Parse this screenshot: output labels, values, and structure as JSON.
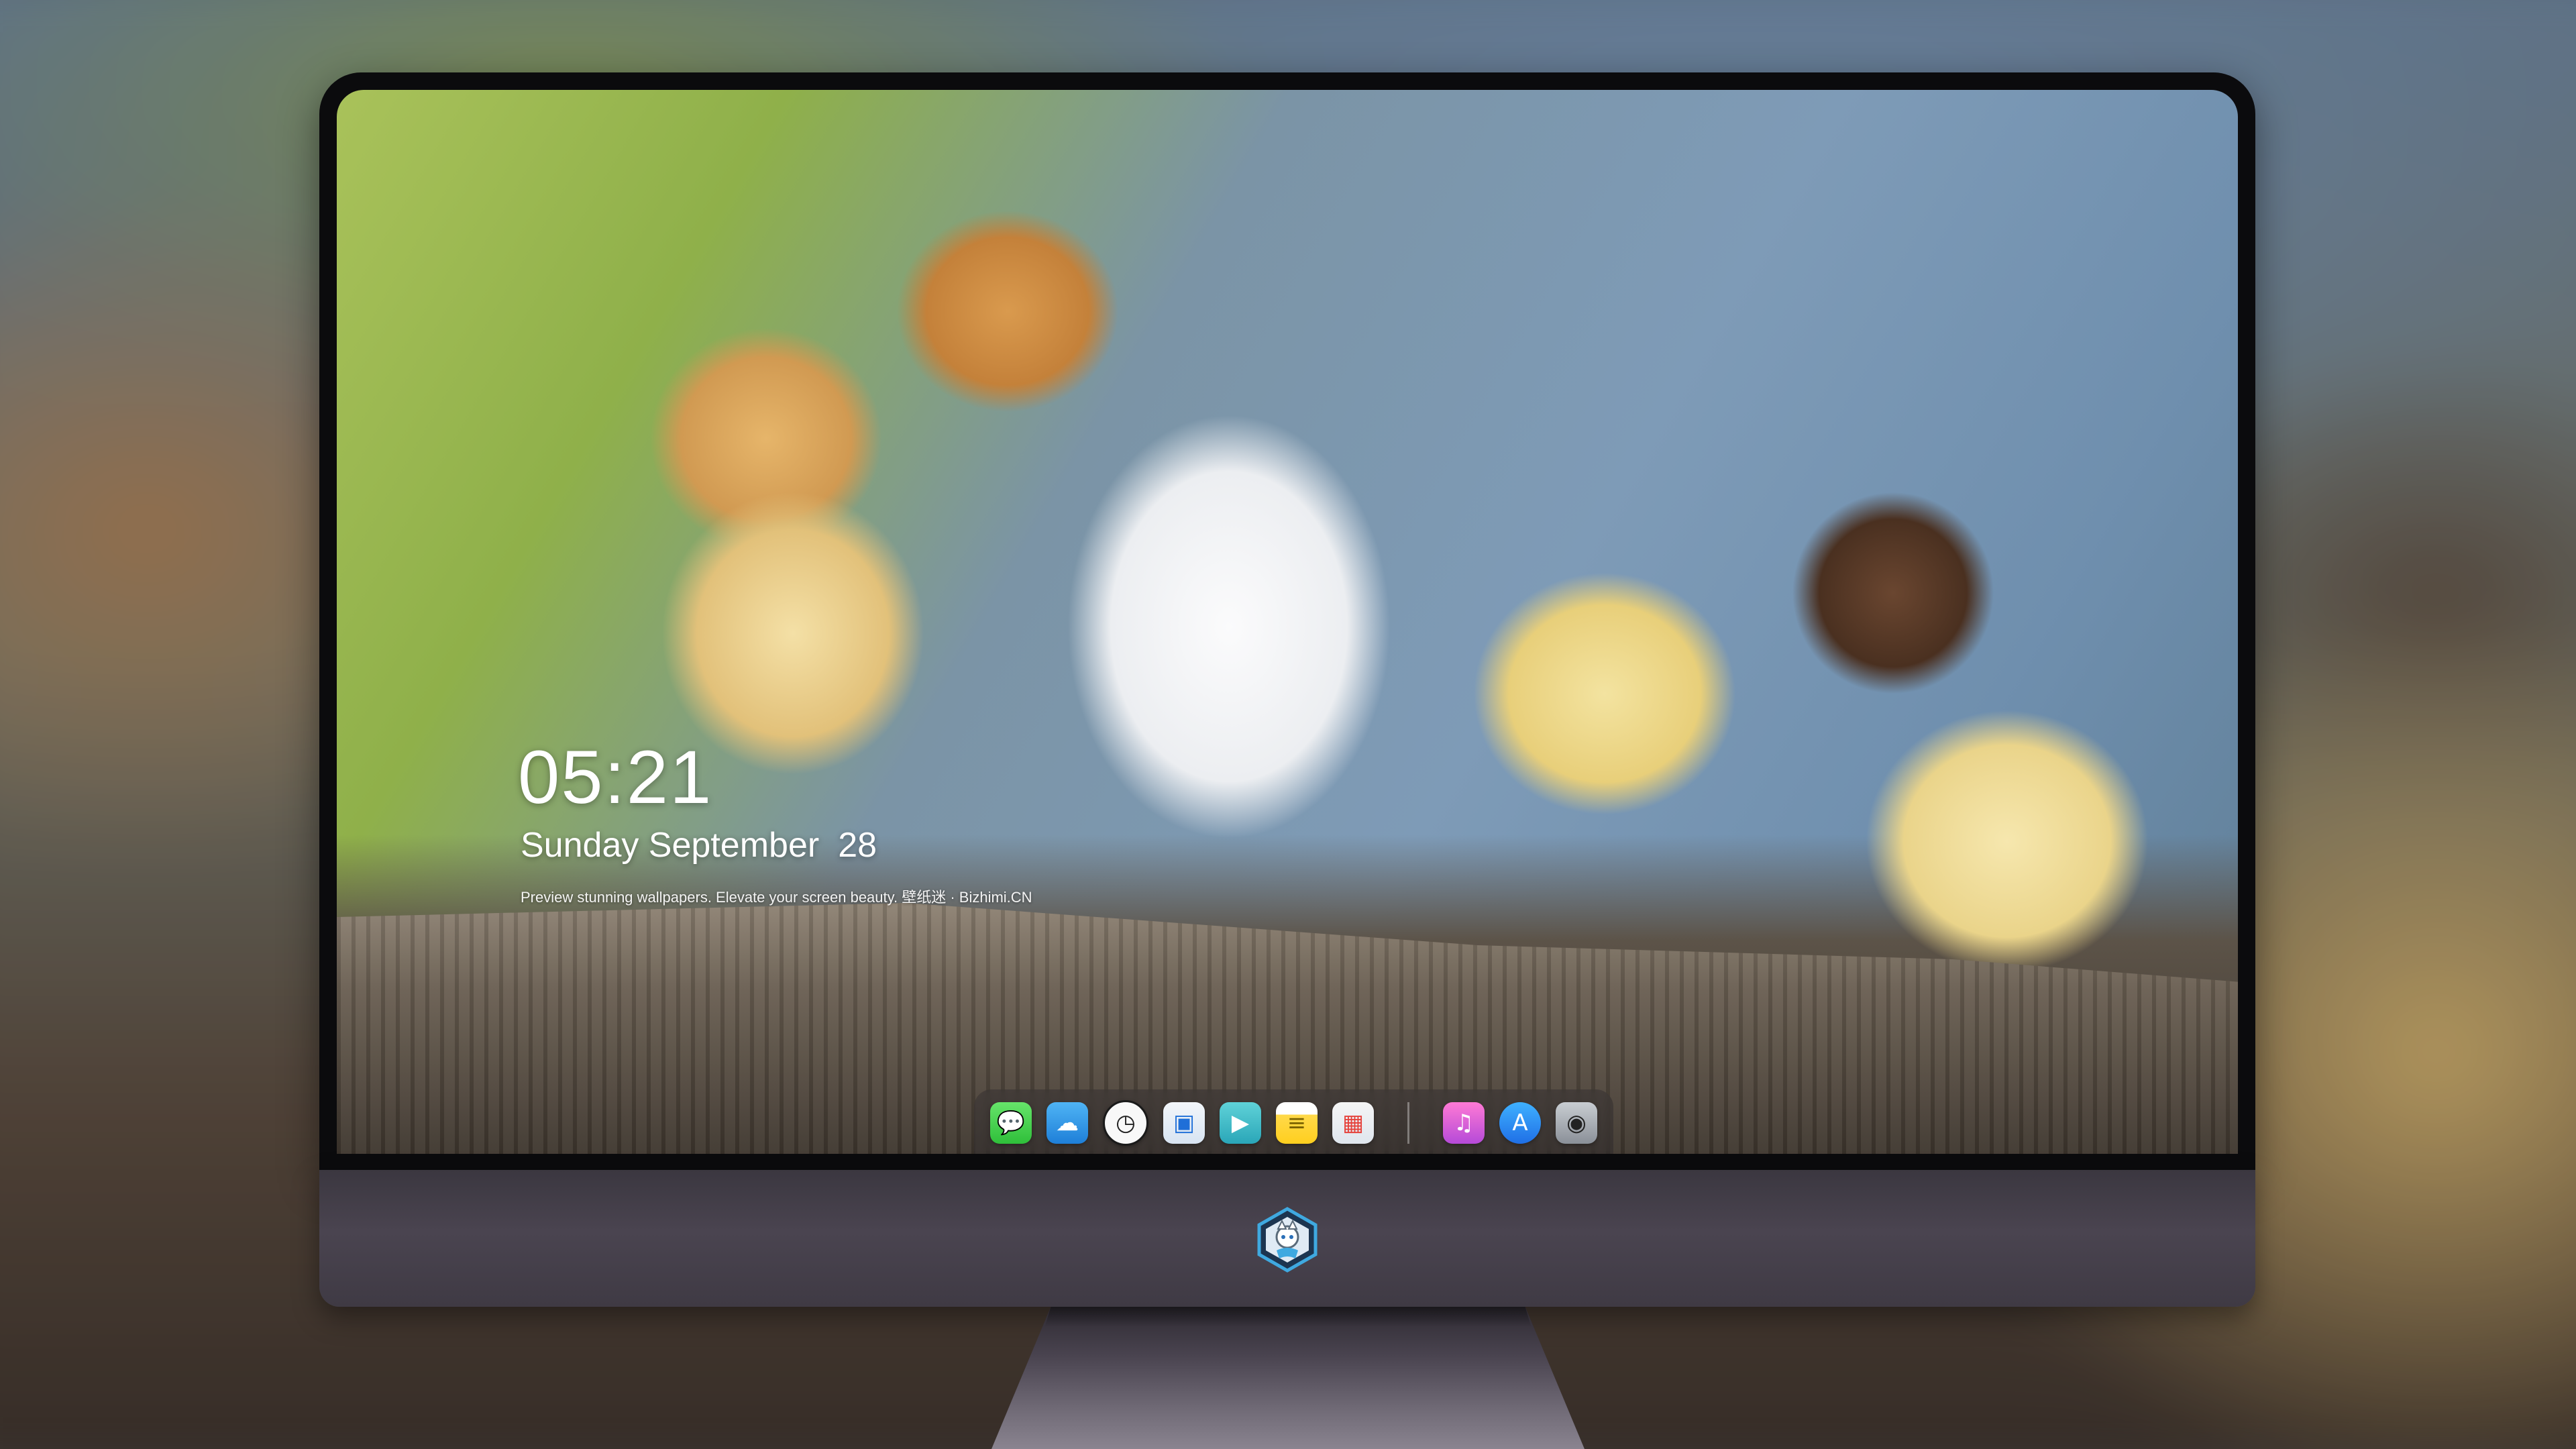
{
  "lock_screen": {
    "time": "05:21",
    "date_text": "Sunday September",
    "day_number": "28",
    "tagline": "Preview stunning wallpapers. Elevate your screen beauty. 壁纸迷 · Bizhimi.CN"
  },
  "dock": {
    "apps": [
      {
        "name": "messages-icon",
        "glyph": "💬"
      },
      {
        "name": "weather-icon",
        "glyph": "☁"
      },
      {
        "name": "clock-icon",
        "glyph": "◷"
      },
      {
        "name": "preview-icon",
        "glyph": "▣"
      },
      {
        "name": "video-icon",
        "glyph": "▶"
      },
      {
        "name": "notes-icon",
        "glyph": "≡"
      },
      {
        "name": "store-icon",
        "glyph": "▦"
      },
      {
        "name": "music-icon",
        "glyph": "♫"
      },
      {
        "name": "app-store-icon",
        "glyph": "A"
      },
      {
        "name": "camera-icon",
        "glyph": "◉"
      }
    ]
  },
  "colors": {
    "bezel": "#0b0b0d",
    "chin": "#4a4450",
    "text": "#ffffff"
  }
}
